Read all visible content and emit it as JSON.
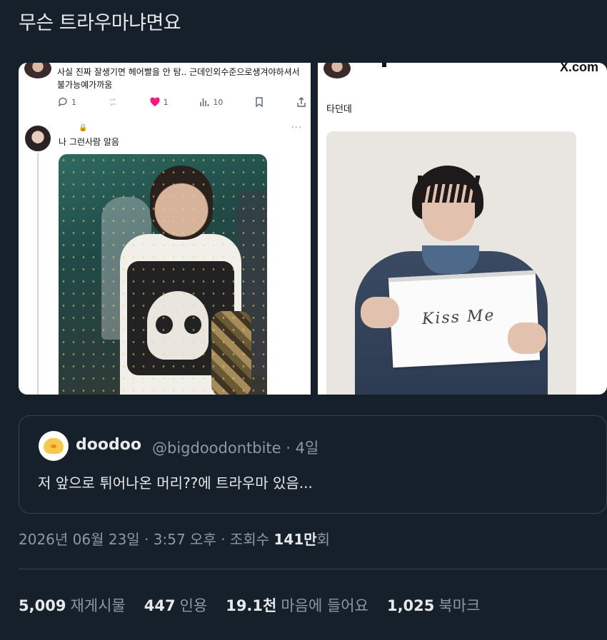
{
  "tweet": {
    "text": "무슨 트라우마냐면요"
  },
  "media": {
    "left": {
      "quote_text": "사실 진짜 잘생기면 헤어빨을 안 탐.. 근데인외수준으로생겨야하셔서 불가능예가까움",
      "actions": {
        "reply_count": "1",
        "like_count": "1",
        "view_count": "10"
      },
      "reply_text": "나 그런사람 알음",
      "more": "···"
    },
    "right": {
      "brand": "X.com",
      "text": "타던데",
      "sign_text": "Kiss Me"
    }
  },
  "quote": {
    "name": "doodoo",
    "handle": "@bigdoodontbite · 4일",
    "text": "저 앞으로 튀어나온 머리??에 트라우마 있음..."
  },
  "meta": {
    "prefix": "2026년 06월 23일 · 3:57 오후 · 조회수 ",
    "views": "141만",
    "suffix": "회"
  },
  "stats": [
    {
      "count": "5,009",
      "label": "재게시물"
    },
    {
      "count": "447",
      "label": "인용"
    },
    {
      "count": "19.1천",
      "label": "마음에 들어요"
    },
    {
      "count": "1,025",
      "label": "북마크"
    }
  ],
  "colors": {
    "background": "#15202b",
    "text": "#e7e9ea",
    "muted": "#8b98a5",
    "border": "#38444d",
    "like": "#f91880"
  }
}
